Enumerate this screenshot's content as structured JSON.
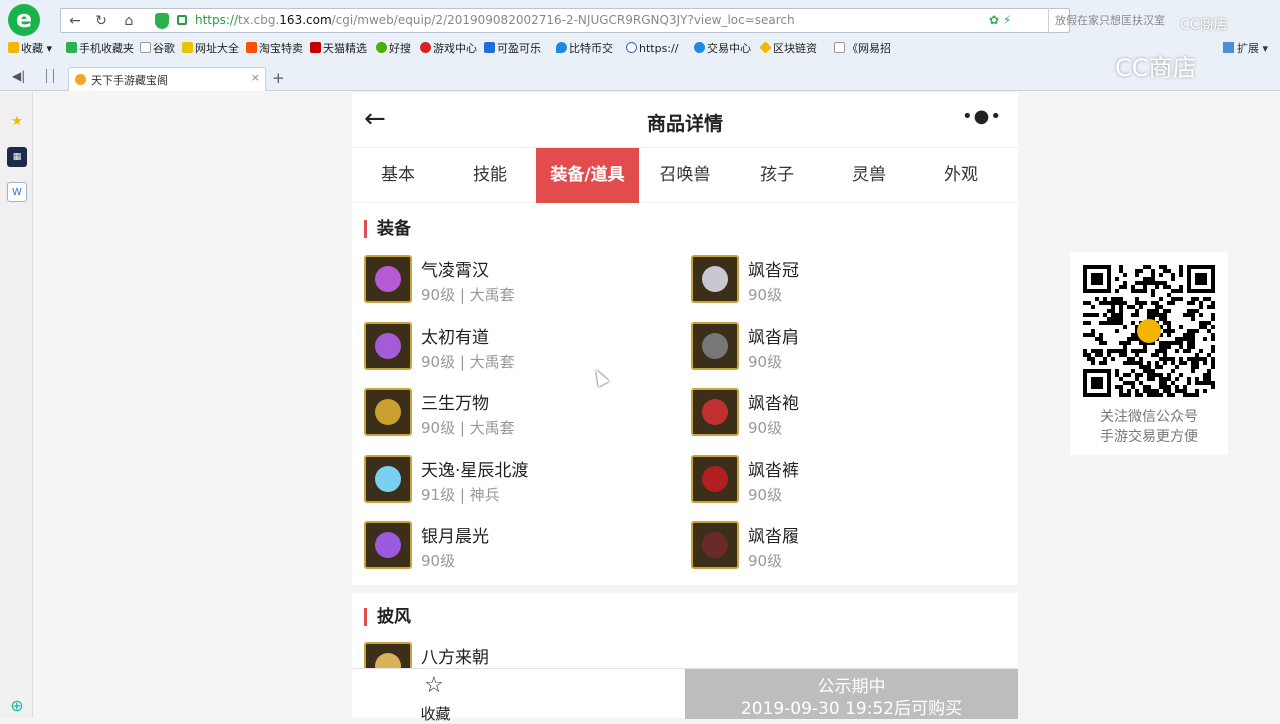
{
  "browser": {
    "url_scheme": "https://",
    "url_host_pre": "tx.cbg.",
    "url_host": "163.com",
    "url_path": "/cgi/mweb/equip/2/201909082002716-2-NJUGCR9RGNQ3JY?view_loc=search",
    "search_text": "放假在家只想匡扶汉室",
    "watermark": "CC商店",
    "bookmarks": [
      "收藏",
      "手机收藏夹",
      "谷歌",
      "网址大全",
      "淘宝特卖",
      "天猫精选",
      "好搜",
      "游戏中心",
      "可盈可乐",
      "比特币交",
      "https://",
      "交易中心",
      "区块链资",
      "《网易招"
    ],
    "extensions_label": "扩展",
    "tab_title": "天下手游藏宝阁"
  },
  "header": {
    "title": "商品详情"
  },
  "tabs": [
    {
      "label": "基本"
    },
    {
      "label": "技能"
    },
    {
      "label": "装备/道具"
    },
    {
      "label": "召唤兽"
    },
    {
      "label": "孩子"
    },
    {
      "label": "灵兽"
    },
    {
      "label": "外观"
    }
  ],
  "active_tab": "装备/道具",
  "equipment": {
    "heading": "装备",
    "items": [
      {
        "name": "气凌霄汉",
        "detail": "90级 | 大禹套",
        "icon": "gold-amulet-icon"
      },
      {
        "name": "飒沓冠",
        "detail": "90级",
        "icon": "silver-helmet-icon"
      },
      {
        "name": "太初有道",
        "detail": "90级 | 大禹套",
        "icon": "gold-ring-icon"
      },
      {
        "name": "飒沓肩",
        "detail": "90级",
        "icon": "shoulder-armor-icon"
      },
      {
        "name": "三生万物",
        "detail": "90级 | 大禹套",
        "icon": "gold-pendant-icon"
      },
      {
        "name": "飒沓袍",
        "detail": "90级",
        "icon": "red-robe-icon"
      },
      {
        "name": "天逸·星辰北渡",
        "detail": "91级 | 神兵",
        "icon": "blue-crystal-weapon-icon"
      },
      {
        "name": "飒沓裤",
        "detail": "90级",
        "icon": "red-pants-icon"
      },
      {
        "name": "银月晨光",
        "detail": "90级",
        "icon": "purple-blade-icon"
      },
      {
        "name": "飒沓履",
        "detail": "90级",
        "icon": "boots-icon"
      }
    ]
  },
  "cape": {
    "heading": "披风",
    "items": [
      {
        "name": "八方来朝",
        "icon": "cape-icon"
      }
    ]
  },
  "bottom_bar": {
    "favorite_label": "收藏",
    "buy_line1": "公示期中",
    "buy_line2": "2019-09-30 19:52后可购买"
  },
  "qr": {
    "caption_line1": "关注微信公众号",
    "caption_line2": "手游交易更方便"
  },
  "colors": {
    "accent": "#e34c4c",
    "frame_gold": "#c8a53a",
    "disabled_gray": "#bdbdbd"
  }
}
